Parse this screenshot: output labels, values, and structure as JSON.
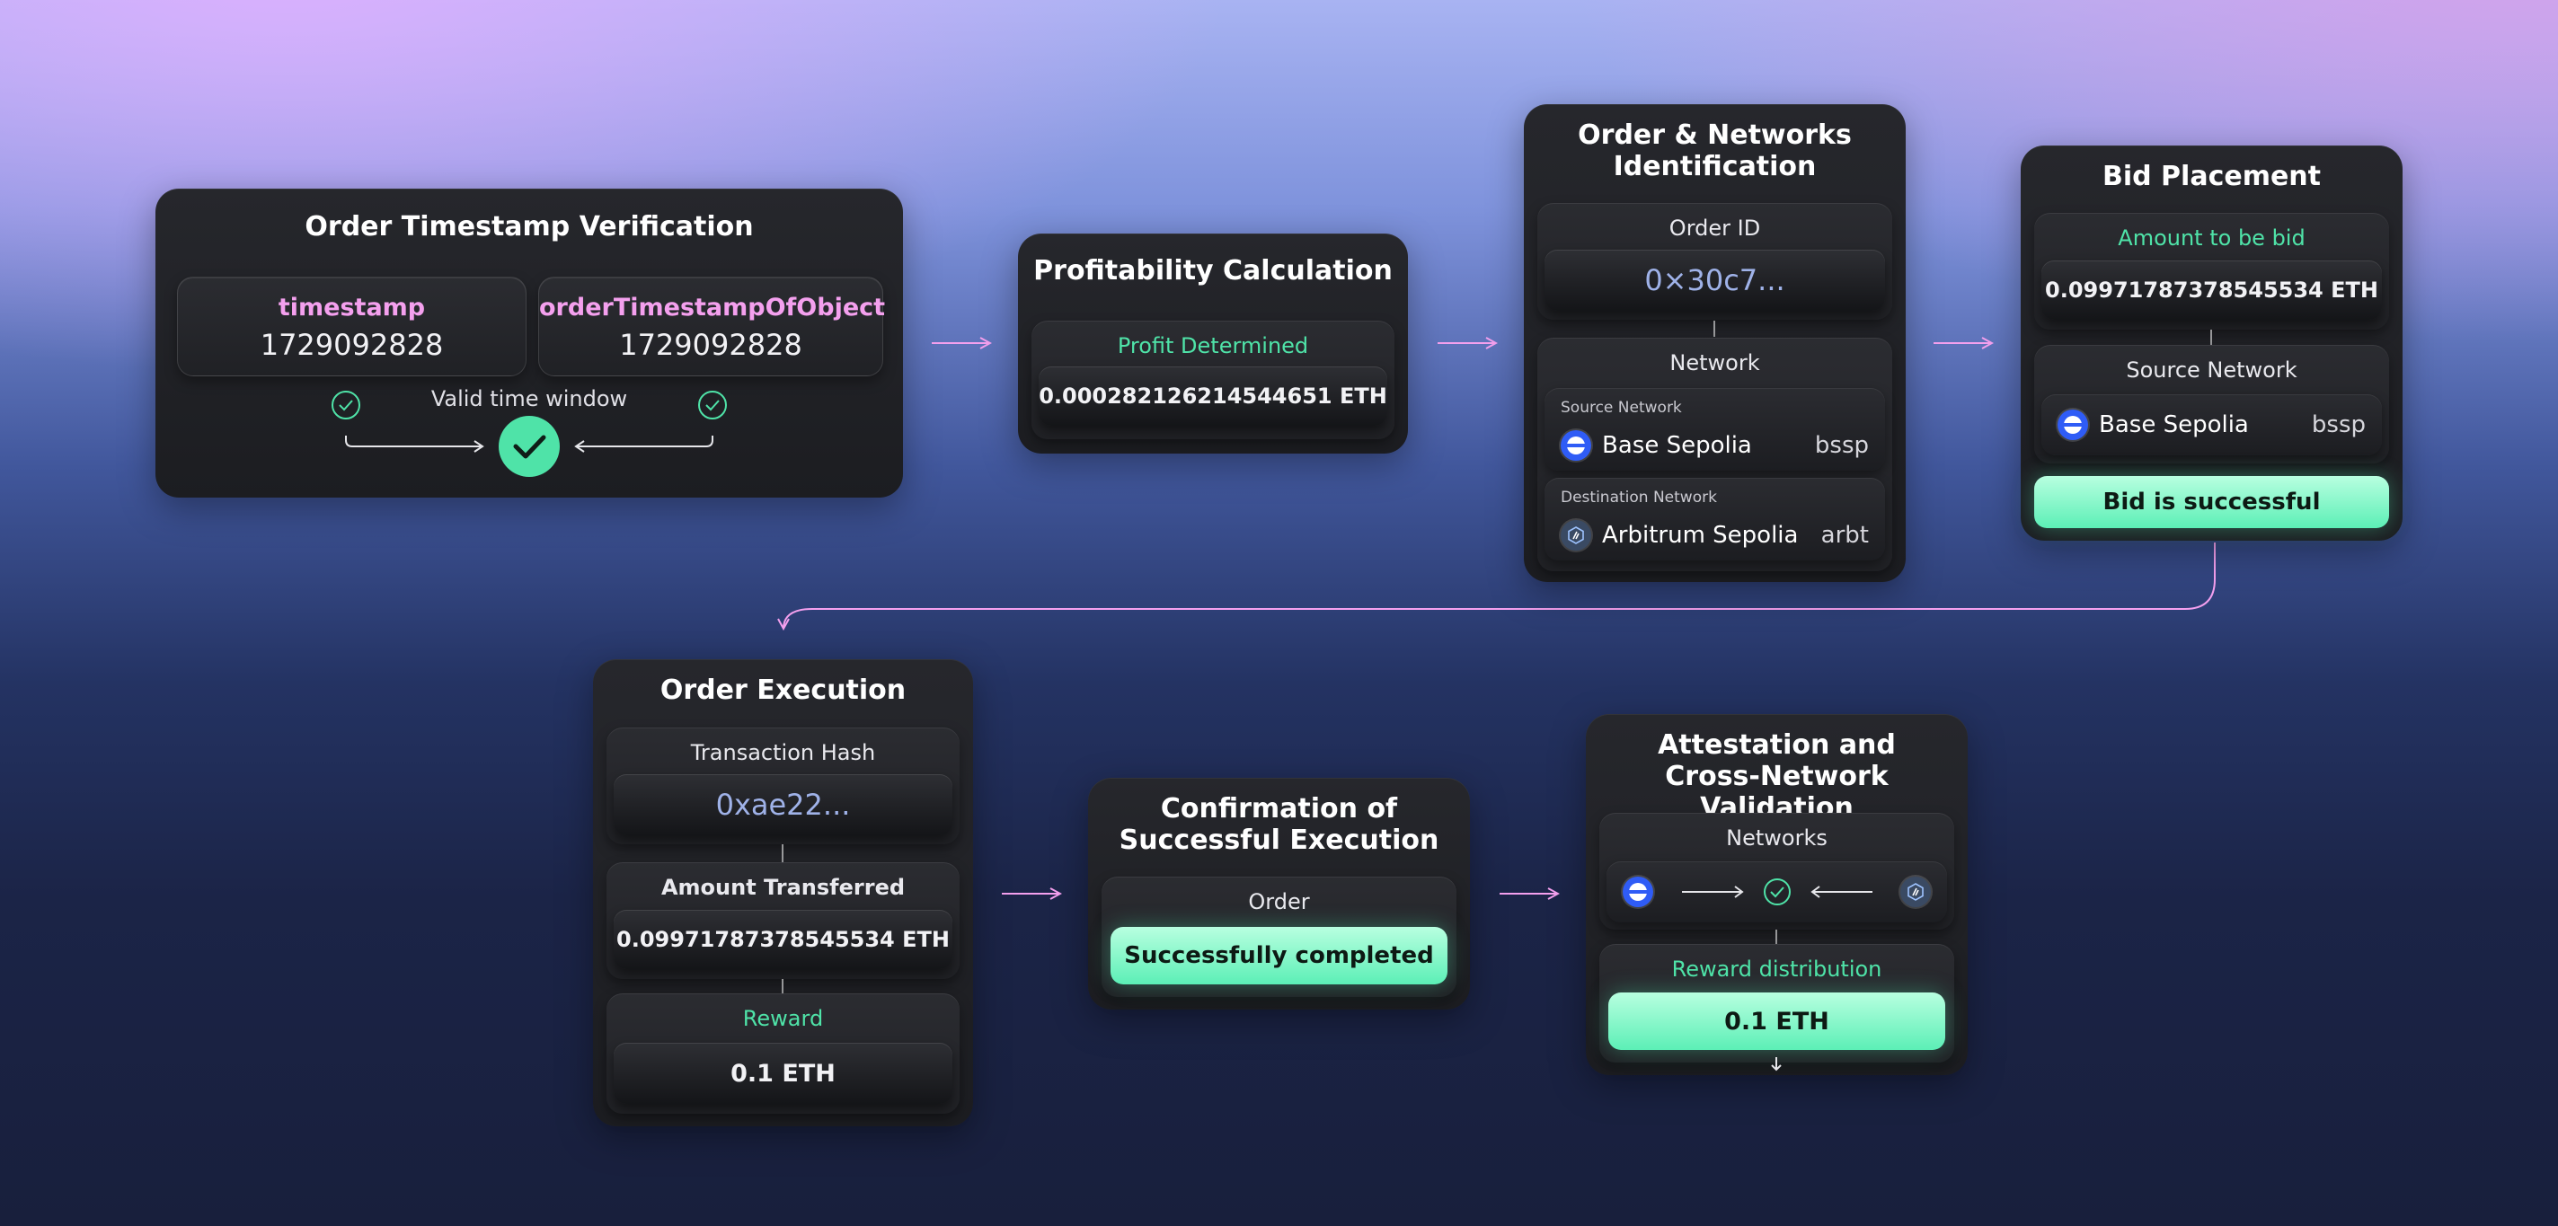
{
  "colors": {
    "accent_green": "#4fe3a8",
    "accent_pink": "#f4a0ee",
    "card_bg": "#1f2024",
    "base_blue": "#2f5cf6"
  },
  "timestamp_card": {
    "title": "Order Timestamp Verification",
    "left_label": "timestamp",
    "left_value": "1729092828",
    "right_label": "orderTimestampOfObject",
    "right_value": "1729092828",
    "window_label": "Valid time window",
    "icons": [
      "check-circle-icon",
      "check-circle-icon",
      "check-badge-icon"
    ]
  },
  "profit_card": {
    "title": "Profitability Calculation",
    "label": "Profit Determined",
    "value": "0.000282126214544651 ETH"
  },
  "network_card": {
    "title_line1": "Order & Networks",
    "title_line2": "Identification",
    "order_id_label": "Order ID",
    "order_id_value": "0×30c7...",
    "network_label": "Network",
    "source_small": "Source Network",
    "source_name": "Base Sepolia",
    "source_code": "bssp",
    "dest_small": "Destination Network",
    "dest_name": "Arbitrum Sepolia",
    "dest_code": "arbt"
  },
  "bid_card": {
    "title": "Bid Placement",
    "amount_label": "Amount to be bid",
    "amount_value": "0.09971787378545534 ETH",
    "source_label": "Source Network",
    "source_name": "Base Sepolia",
    "source_code": "bssp",
    "status": "Bid is successful"
  },
  "execution_card": {
    "title": "Order Execution",
    "tx_label": "Transaction Hash",
    "tx_value": "0xae22...",
    "amount_label": "Amount Transferred",
    "amount_value": "0.09971787378545534 ETH",
    "reward_label": "Reward",
    "reward_value": "0.1 ETH"
  },
  "confirm_card": {
    "title_line1": "Confirmation of",
    "title_line2": "Successful Execution",
    "order_label": "Order",
    "status": "Successfully completed"
  },
  "attest_card": {
    "title_line1": "Attestation and",
    "title_line2": "Cross-Network Validation",
    "networks_label": "Networks",
    "reward_label": "Reward distribution",
    "reward_value": "0.1 ETH"
  }
}
